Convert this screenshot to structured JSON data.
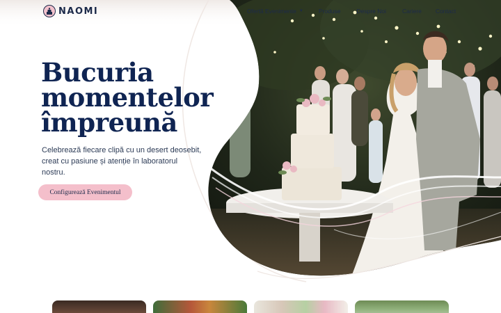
{
  "brand": {
    "name": "NAOMI",
    "logo_icon": "cake-icon"
  },
  "nav": {
    "items": [
      {
        "label": "Ofertă Evenimente",
        "has_dropdown": true
      },
      {
        "label": "Produse"
      },
      {
        "label": "Despre Noi"
      },
      {
        "label": "Cariere"
      },
      {
        "label": "Contact"
      }
    ]
  },
  "hero": {
    "title_lines": [
      "Bucuria",
      "momentelor",
      "împreună"
    ],
    "subtitle_lines": [
      "Celebrează fiecare clipă cu un desert deosebit,",
      "creat cu pasiune și atenție în laboratorul",
      "nostru."
    ],
    "cta_label": "Configurează Evenimentul",
    "image": "wedding-cake-cutting-photo"
  },
  "colors": {
    "navy": "#0f2452",
    "pink": "#f4bfcb",
    "white": "#ffffff"
  },
  "cards": [
    {
      "image": "dessert-photo"
    },
    {
      "image": "cupcakes-photo"
    },
    {
      "image": "flowers-cake-photo"
    },
    {
      "image": "garden-event-photo"
    }
  ]
}
